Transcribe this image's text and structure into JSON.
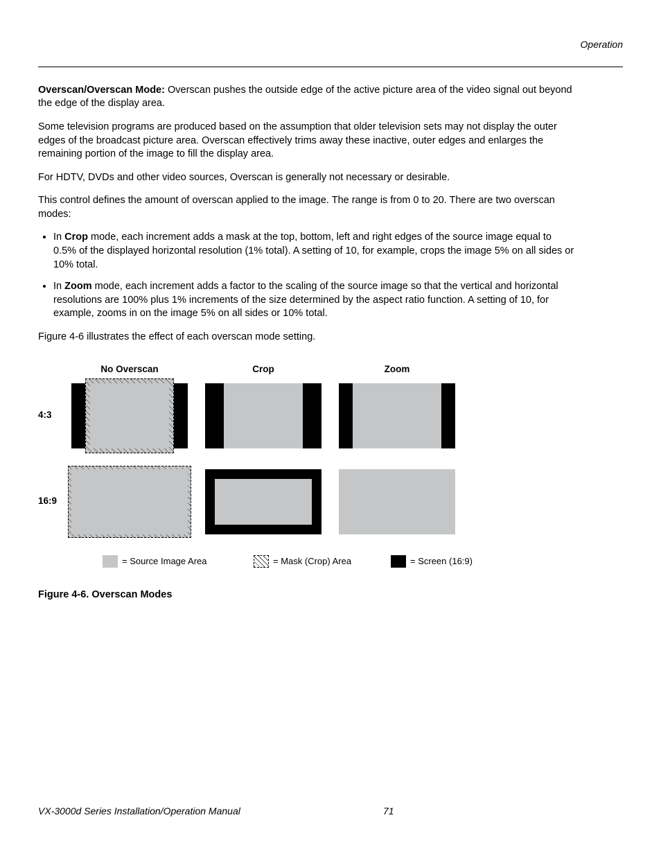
{
  "header": {
    "section": "Operation"
  },
  "intro": {
    "lead_bold": "Overscan/Overscan Mode:",
    "lead_rest": " Overscan pushes the outside edge of the active picture area of the video signal out beyond the edge of the display area.",
    "para2": "Some television programs are produced based on the assumption that older television sets may not display the outer edges of the broadcast picture area. Overscan effectively trims away these inactive, outer edges and enlarges the remaining portion of the image to fill the display area.",
    "para3": "For HDTV, DVDs and other video sources, Overscan is generally not necessary or desirable.",
    "para4": "This control defines the amount of overscan applied to the image. The range is from 0 to 20. There are two overscan modes:"
  },
  "bullets": {
    "b1_pre": "In ",
    "b1_bold": "Crop",
    "b1_post": " mode, each increment adds a mask at the top, bottom, left and right edges of the source image equal to 0.5% of the displayed horizontal resolution (1% total). A setting of 10, for example, crops the image 5% on all sides or 10% total.",
    "b2_pre": "In ",
    "b2_bold": "Zoom",
    "b2_post": " mode, each increment adds a factor to the scaling of the source image so that the vertical and horizontal resolutions are 100% plus 1% increments of the size determined by the aspect ratio function. A setting of 10, for example, zooms in on the image 5% on all sides or 10% total."
  },
  "after_bullets": "Figure 4-6 illustrates the effect of each overscan mode setting.",
  "figure": {
    "columns": {
      "c1": "No Overscan",
      "c2": "Crop",
      "c3": "Zoom"
    },
    "rows": {
      "r1": "4:3",
      "r2": "16:9"
    },
    "legend": {
      "l1": "= Source Image Area",
      "l2": "= Mask (Crop) Area",
      "l3": "= Screen (16:9)"
    },
    "caption": "Figure 4-6. Overscan Modes"
  },
  "footer": {
    "manual_title": "VX-3000d Series Installation/Operation Manual",
    "page_number": "71"
  }
}
